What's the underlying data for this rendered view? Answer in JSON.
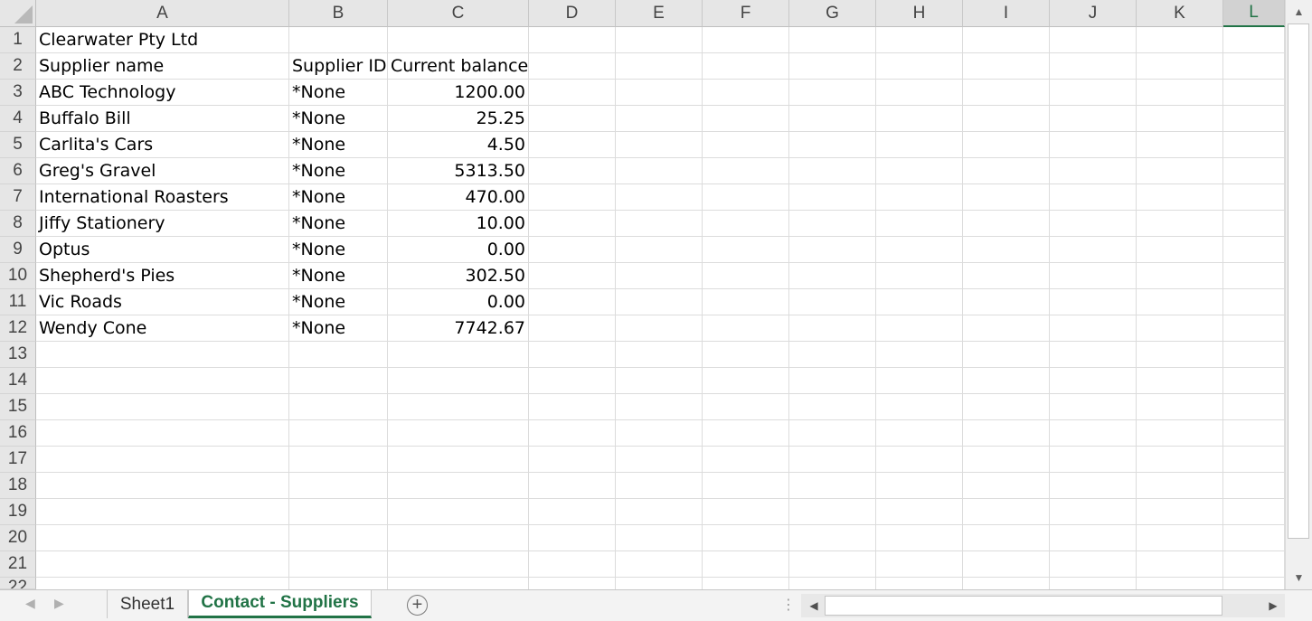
{
  "columns": [
    "A",
    "B",
    "C",
    "D",
    "E",
    "F",
    "G",
    "H",
    "I",
    "J",
    "K",
    "L"
  ],
  "selected_column": "L",
  "row_numbers": [
    "1",
    "2",
    "3",
    "4",
    "5",
    "6",
    "7",
    "8",
    "9",
    "10",
    "11",
    "12",
    "13",
    "14",
    "15",
    "16",
    "17",
    "18",
    "19",
    "20",
    "21",
    "22"
  ],
  "rows": [
    {
      "a": "Clearwater Pty Ltd",
      "b": "",
      "c": ""
    },
    {
      "a": "Supplier name",
      "b": "Supplier ID",
      "c": "Current balance"
    },
    {
      "a": "ABC Technology",
      "b": "*None",
      "c": "1200.00"
    },
    {
      "a": "Buffalo Bill",
      "b": "*None",
      "c": "25.25"
    },
    {
      "a": "Carlita's Cars",
      "b": "*None",
      "c": "4.50"
    },
    {
      "a": "Greg's Gravel",
      "b": "*None",
      "c": "5313.50"
    },
    {
      "a": "International Roasters",
      "b": "*None",
      "c": "470.00"
    },
    {
      "a": "Jiffy Stationery",
      "b": "*None",
      "c": "10.00"
    },
    {
      "a": "Optus",
      "b": "*None",
      "c": "0.00"
    },
    {
      "a": "Shepherd's Pies",
      "b": "*None",
      "c": "302.50"
    },
    {
      "a": "Vic Roads",
      "b": "*None",
      "c": "0.00"
    },
    {
      "a": "Wendy Cone",
      "b": "*None",
      "c": "7742.67"
    }
  ],
  "sheet_tabs": [
    {
      "label": "Sheet1",
      "active": false
    },
    {
      "label": "Contact - Suppliers",
      "active": true
    }
  ],
  "icons": {
    "add_sheet": "plus-circle-icon",
    "scroll_up": "triangle-up-icon",
    "scroll_down": "triangle-down-icon",
    "scroll_left": "triangle-left-icon",
    "scroll_right": "triangle-right-icon"
  },
  "colors": {
    "accent": "#217346"
  }
}
